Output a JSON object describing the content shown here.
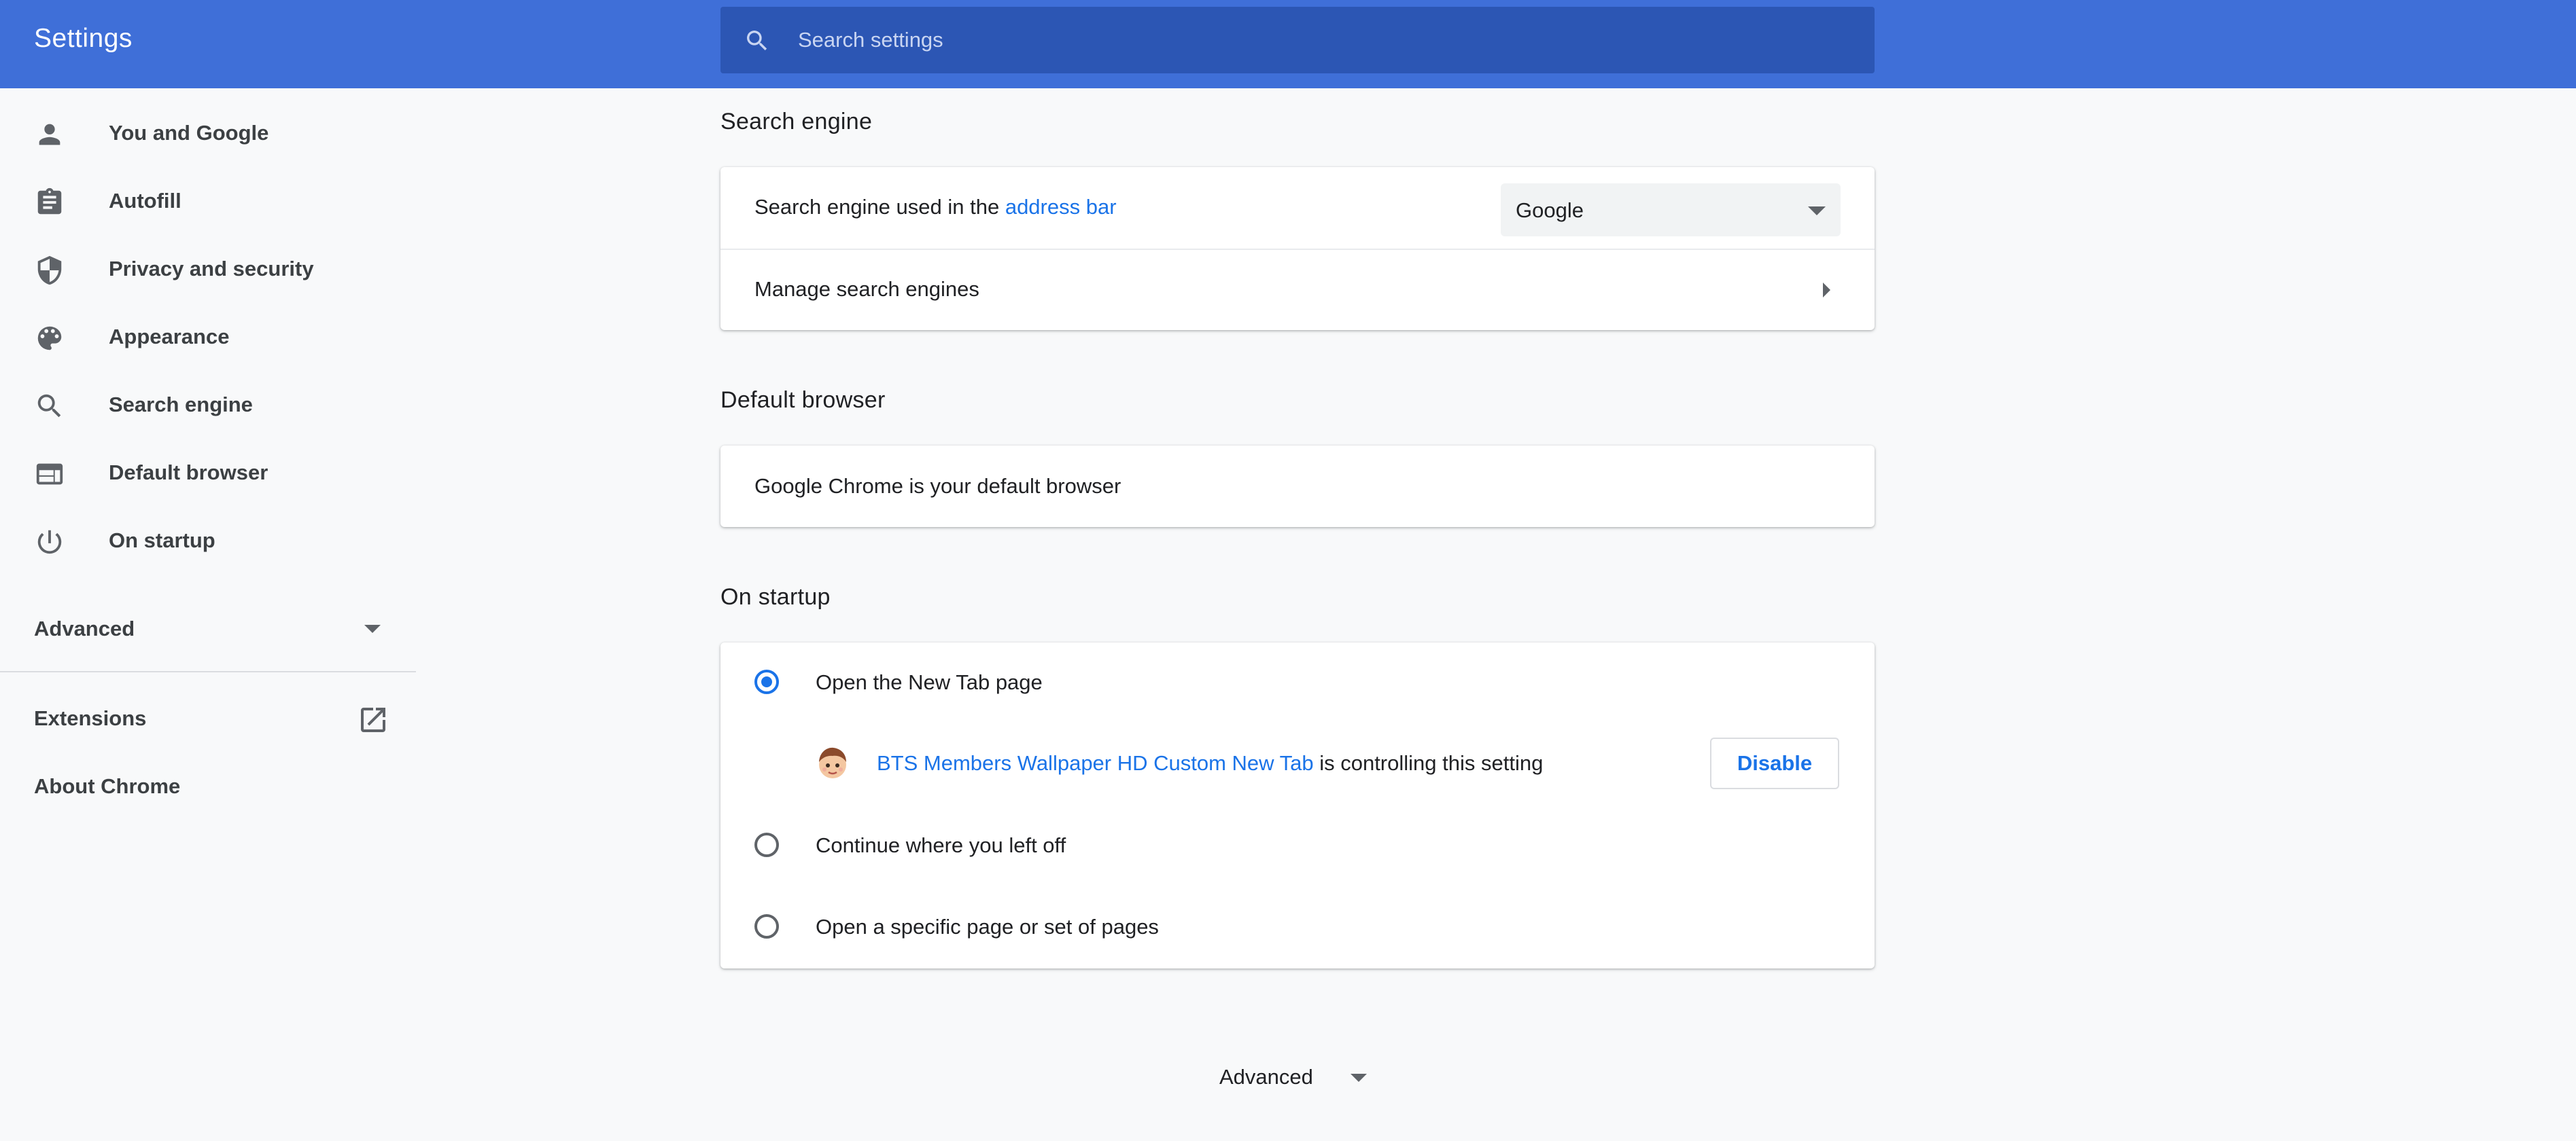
{
  "header": {
    "title": "Settings",
    "search_placeholder": "Search settings",
    "search_value": ""
  },
  "sidebar": {
    "items": [
      {
        "label": "You and Google",
        "icon": "person-icon"
      },
      {
        "label": "Autofill",
        "icon": "clipboard-icon"
      },
      {
        "label": "Privacy and security",
        "icon": "shield-icon"
      },
      {
        "label": "Appearance",
        "icon": "palette-icon"
      },
      {
        "label": "Search engine",
        "icon": "search-icon"
      },
      {
        "label": "Default browser",
        "icon": "browser-window-icon"
      },
      {
        "label": "On startup",
        "icon": "power-icon"
      }
    ],
    "advanced_label": "Advanced",
    "extensions_label": "Extensions",
    "about_label": "About Chrome"
  },
  "search_engine": {
    "title": "Search engine",
    "used_in_prefix": "Search engine used in the ",
    "used_in_link": "address bar",
    "selected_engine": "Google",
    "manage_label": "Manage search engines"
  },
  "default_browser": {
    "title": "Default browser",
    "status": "Google Chrome is your default browser"
  },
  "on_startup": {
    "title": "On startup",
    "options": [
      {
        "label": "Open the New Tab page",
        "checked": true
      },
      {
        "label": "Continue where you left off",
        "checked": false
      },
      {
        "label": "Open a specific page or set of pages",
        "checked": false
      }
    ],
    "extension_name": "BTS Members Wallpaper HD Custom New Tab",
    "extension_suffix": " is controlling this setting",
    "disable_label": "Disable"
  },
  "footer": {
    "advanced_label": "Advanced"
  },
  "colors": {
    "header_bg": "#3f6fd8",
    "search_bg": "#2c56b4",
    "accent": "#1a73e8",
    "page_bg": "#f8f9fa"
  }
}
